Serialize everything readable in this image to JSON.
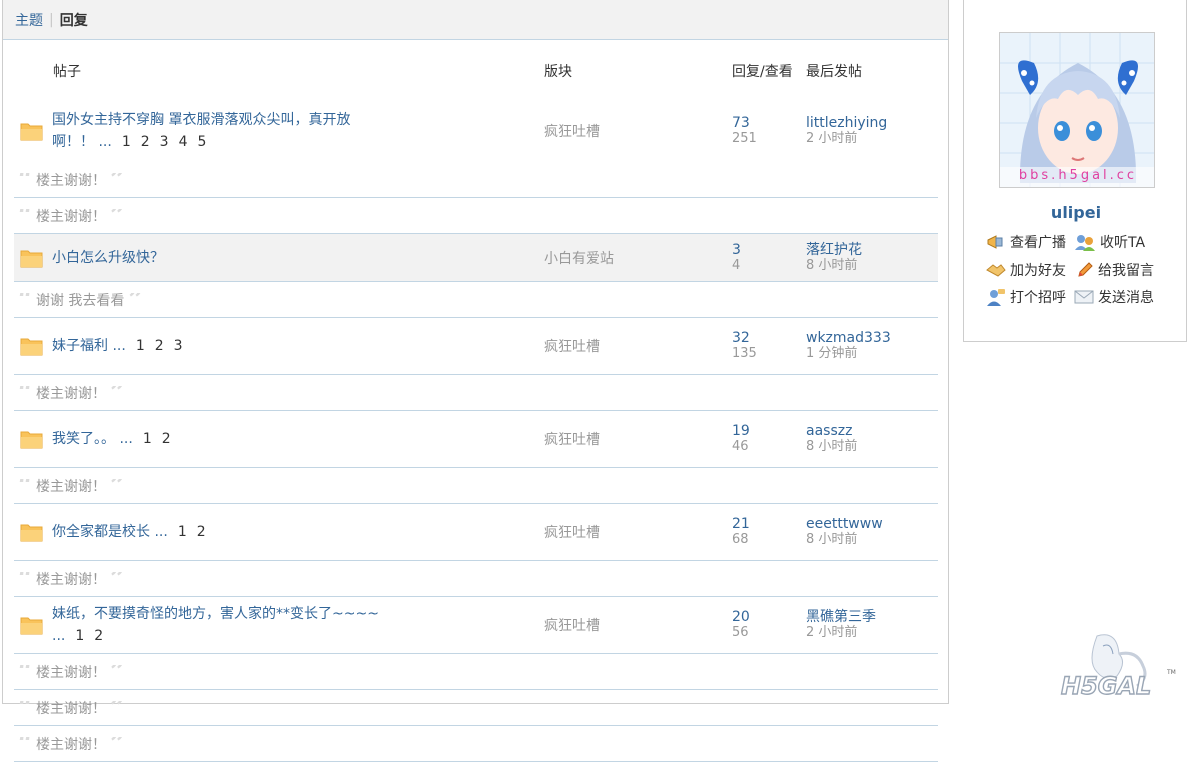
{
  "tabs": {
    "topic": "主题",
    "reply": "回复"
  },
  "columns": {
    "post": "帖子",
    "forum": "版块",
    "reply_view": "回复/查看",
    "last_post": "最后发帖"
  },
  "rows": [
    {
      "title": "国外女主持不穿胸 罩衣服滑落观众尖叫，真开放啊！！",
      "ellipsis": "...",
      "pages": [
        "1",
        "2",
        "3",
        "4",
        "5"
      ],
      "forum": "疯狂吐槽",
      "replies": "73",
      "views": "251",
      "last_user": "littlezhiying",
      "last_time": "2 小时前",
      "quotes": [
        "楼主谢谢！",
        "楼主谢谢！"
      ]
    },
    {
      "title": "小白怎么升级快？",
      "ellipsis": "",
      "pages": [],
      "forum": "小白有爱站",
      "replies": "3",
      "views": "4",
      "last_user": "落红护花",
      "last_time": "8 小时前",
      "quotes": [
        "谢谢 我去看看"
      ]
    },
    {
      "title": "妹子福利",
      "ellipsis": "...",
      "pages": [
        "1",
        "2",
        "3"
      ],
      "forum": "疯狂吐槽",
      "replies": "32",
      "views": "135",
      "last_user": "wkzmad333",
      "last_time": "1 分钟前",
      "quotes": [
        "楼主谢谢！"
      ]
    },
    {
      "title": "我笑了。。",
      "ellipsis": "...",
      "pages": [
        "1",
        "2"
      ],
      "forum": "疯狂吐槽",
      "replies": "19",
      "views": "46",
      "last_user": "aasszz",
      "last_time": "8 小时前",
      "quotes": [
        "楼主谢谢！"
      ]
    },
    {
      "title": "你全家都是校长",
      "ellipsis": "...",
      "pages": [
        "1",
        "2"
      ],
      "forum": "疯狂吐槽",
      "replies": "21",
      "views": "68",
      "last_user": "eeetttwww",
      "last_time": "8 小时前",
      "quotes": [
        "楼主谢谢！"
      ]
    },
    {
      "title": "妹纸，不要摸奇怪的地方，害人家的**变长了~~~~",
      "ellipsis": "...",
      "pages": [
        "1",
        "2"
      ],
      "forum": "疯狂吐槽",
      "replies": "20",
      "views": "56",
      "last_user": "黑礁第三季",
      "last_time": "2 小时前",
      "quotes": [
        "楼主谢谢！",
        "楼主谢谢！",
        "楼主谢谢！"
      ]
    }
  ],
  "profile": {
    "avatar_caption": "bbs.h5gal.cc",
    "username": "ulipei",
    "actions": {
      "broadcast": "查看广播",
      "follow": "收听TA",
      "add_friend": "加为好友",
      "leave_message": "给我留言",
      "greet": "打个招呼",
      "send_message": "发送消息"
    }
  },
  "logo": {
    "text": "H5GAL",
    "tm": "TM"
  },
  "colors": {
    "link": "#336699",
    "muted": "#999999",
    "border": "#c2d5e3",
    "folder": "#f9c35b"
  }
}
